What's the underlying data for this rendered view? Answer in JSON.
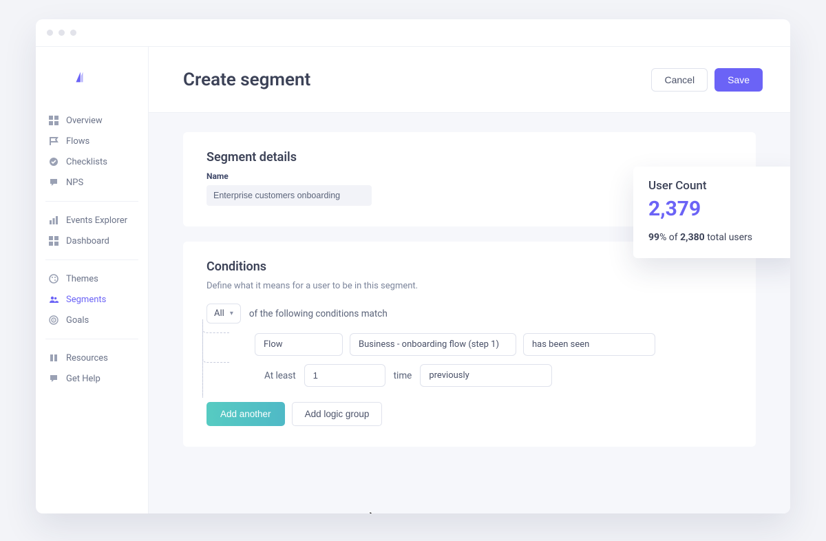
{
  "sidebar": {
    "items": [
      {
        "label": "Overview"
      },
      {
        "label": "Flows"
      },
      {
        "label": "Checklists"
      },
      {
        "label": "NPS"
      },
      {
        "label": "Events Explorer"
      },
      {
        "label": "Dashboard"
      },
      {
        "label": "Themes"
      },
      {
        "label": "Segments"
      },
      {
        "label": "Goals"
      },
      {
        "label": "Resources"
      },
      {
        "label": "Get Help"
      }
    ]
  },
  "header": {
    "title": "Create segment",
    "cancel": "Cancel",
    "save": "Save"
  },
  "segment_details": {
    "title": "Segment details",
    "name_label": "Name",
    "name_value": "Enterprise customers onboarding"
  },
  "conditions": {
    "title": "Conditions",
    "subtitle": "Define what it means for a user to be in this segment.",
    "match_mode": "All",
    "match_text": "of the following conditions match",
    "row1": {
      "type": "Flow",
      "flow_name": "Business - onboarding flow (step 1)",
      "predicate": "has been seen"
    },
    "row2": {
      "prefix": "At least",
      "count": "1",
      "unit": "time",
      "when": "previously"
    },
    "add_another": "Add another",
    "add_logic_group": "Add logic group"
  },
  "user_count": {
    "title": "User Count",
    "count": "2,379",
    "percent": "99",
    "total": "2,380",
    "sub_before": "% of ",
    "sub_after": " total users"
  }
}
